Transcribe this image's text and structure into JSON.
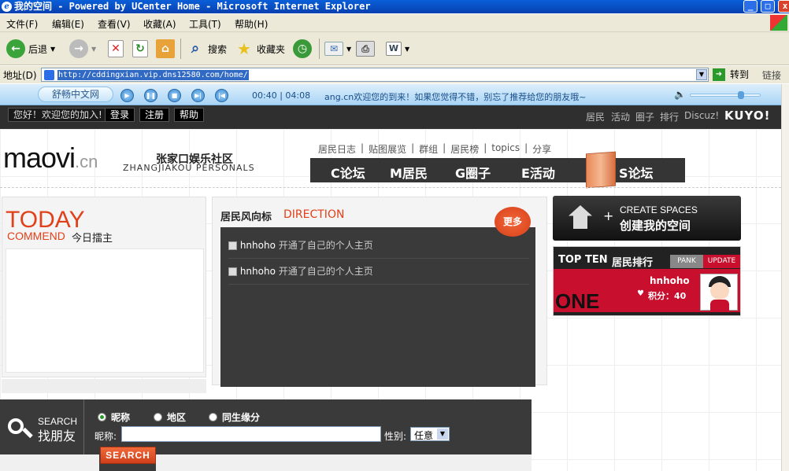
{
  "window": {
    "title": "我的空间 - Powered by UCenter Home - Microsoft Internet Explorer"
  },
  "menu": {
    "items": [
      "文件(F)",
      "编辑(E)",
      "查看(V)",
      "收藏(A)",
      "工具(T)",
      "帮助(H)"
    ]
  },
  "toolbar": {
    "back": "后退",
    "search": "搜索",
    "favorites": "收藏夹"
  },
  "addressbar": {
    "label": "地址(D)",
    "url": "http://cddingxian.vip.dns12580.com/home/",
    "go": "转到",
    "links": "链接"
  },
  "player": {
    "station": "舒畅中文网",
    "time": "00:40 | 04:08",
    "ticker": "ang.cn欢迎您的到来！如果您觉得不错，别忘了推荐给您的朋友哦~"
  },
  "site_topnav": {
    "welcome": "您好！欢迎您的加入!",
    "login": "登录",
    "register": "注册",
    "help": "帮助",
    "right_links": [
      "居民",
      "活动",
      "圈子",
      "排行",
      "Discuz!"
    ],
    "brand": "KUYO!"
  },
  "header": {
    "logo_main": "maovi",
    "logo_suffix": ".cn",
    "site_name_cn": "张家口娱乐社区",
    "site_name_en": "ZHANGJIAKOU PERSONALS",
    "sub_links": [
      "居民日志",
      "贴图展览",
      "群组",
      "居民榜",
      "topics",
      "分享"
    ],
    "main_nav": [
      "C论坛",
      "M居民",
      "G圈子",
      "E活动",
      "S论坛"
    ]
  },
  "today": {
    "title": "TODAY",
    "commend": "COMMEND",
    "subtitle": "今日擂主"
  },
  "direction": {
    "title_cn": "居民风向标",
    "title_en": "DIRECTION",
    "more": "更多",
    "feed": [
      {
        "user": "hnhoho",
        "action": "开通了自己的个人主页"
      },
      {
        "user": "hnhoho",
        "action": "开通了自己的个人主页"
      }
    ]
  },
  "create_space": {
    "en": "CREATE SPACES",
    "cn": "创建我的空间"
  },
  "topten": {
    "title": "TOP TEN",
    "title_cn": "居民排行",
    "tab_rank": "PANK",
    "tab_update": "UPDATE",
    "rank_word": "ONE",
    "user": "hnhoho",
    "score": "积分：40"
  },
  "search": {
    "en": "SEARCH",
    "cn": "找朋友",
    "options": [
      "昵称",
      "地区",
      "同生缘分"
    ],
    "nick_label": "昵称:",
    "gender_label": "性别:",
    "gender_value": "任意",
    "button": "SEARCH"
  }
}
